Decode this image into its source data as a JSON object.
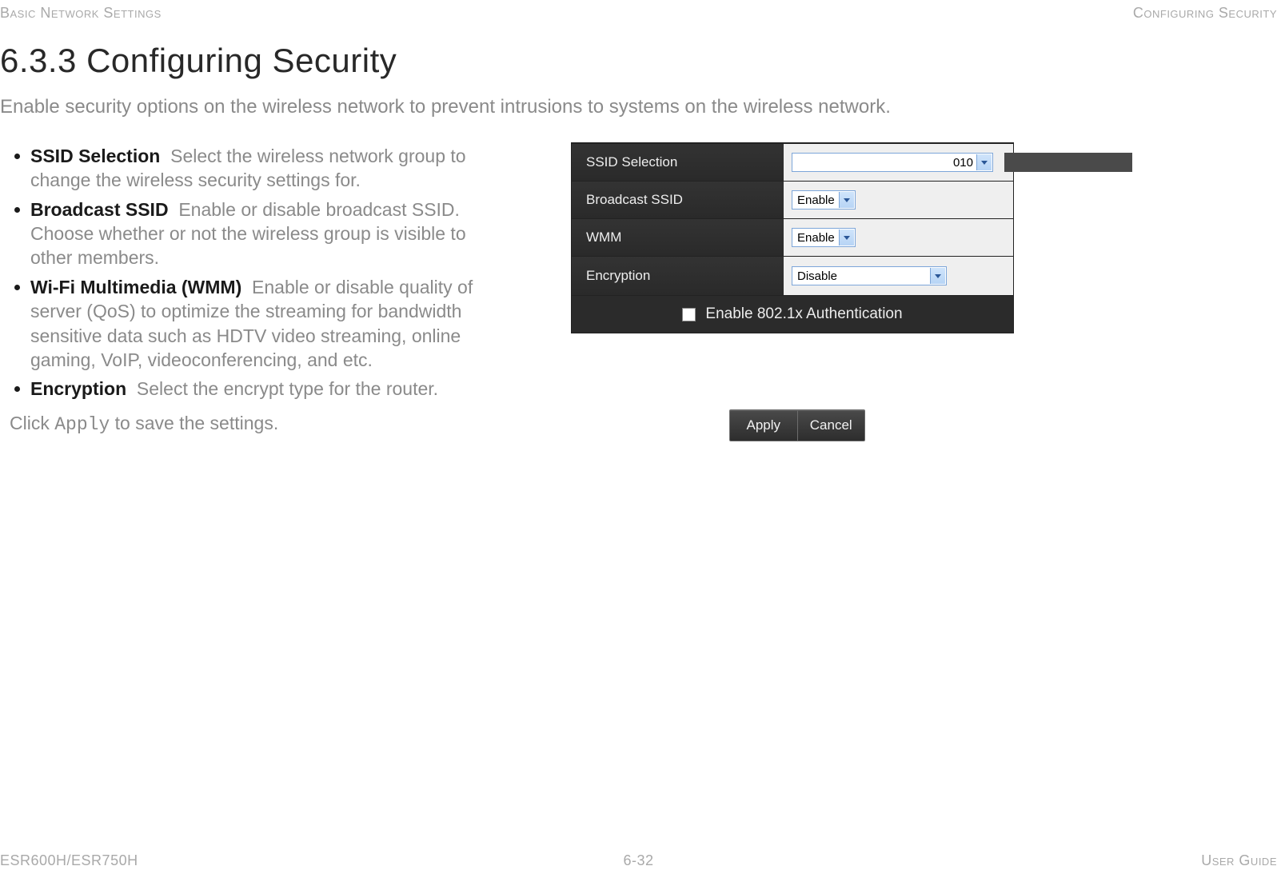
{
  "header": {
    "left": "Basic Network Settings",
    "right": "Configuring Security"
  },
  "footer": {
    "left": "ESR600H/ESR750H",
    "center": "6-32",
    "right": "User Guide"
  },
  "section": {
    "title": "6.3.3 Configuring Security",
    "intro": "Enable security options on the wireless network to prevent intrusions to systems on the wireless network."
  },
  "defs": [
    {
      "term": "SSID Selection",
      "text": "Select the wireless network group to change the wireless security settings for."
    },
    {
      "term": "Broadcast SSID",
      "text": "Enable or disable broadcast SSID. Choose whether or not the wireless group is visible to other members."
    },
    {
      "term": "Wi-Fi Multimedia (WMM)",
      "text": "Enable or disable quality of server (QoS) to optimize the streaming for bandwidth sensitive data such as HDTV video streaming, online gaming, VoIP, videoconferencing, and etc."
    },
    {
      "term": "Encryption",
      "text": "Select the encrypt type for the router."
    }
  ],
  "apply_note": {
    "pre": "Click ",
    "code": "Apply",
    "post": " to save the settings."
  },
  "panel": {
    "rows": {
      "ssid": {
        "label": "SSID Selection",
        "value_visible_suffix": "010"
      },
      "broadcast": {
        "label": "Broadcast SSID",
        "value": "Enable"
      },
      "wmm": {
        "label": "WMM",
        "value": "Enable"
      },
      "encryption": {
        "label": "Encryption",
        "value": "Disable"
      }
    },
    "auth_label": "Enable 802.1x Authentication"
  },
  "buttons": {
    "apply": "Apply",
    "cancel": "Cancel"
  }
}
